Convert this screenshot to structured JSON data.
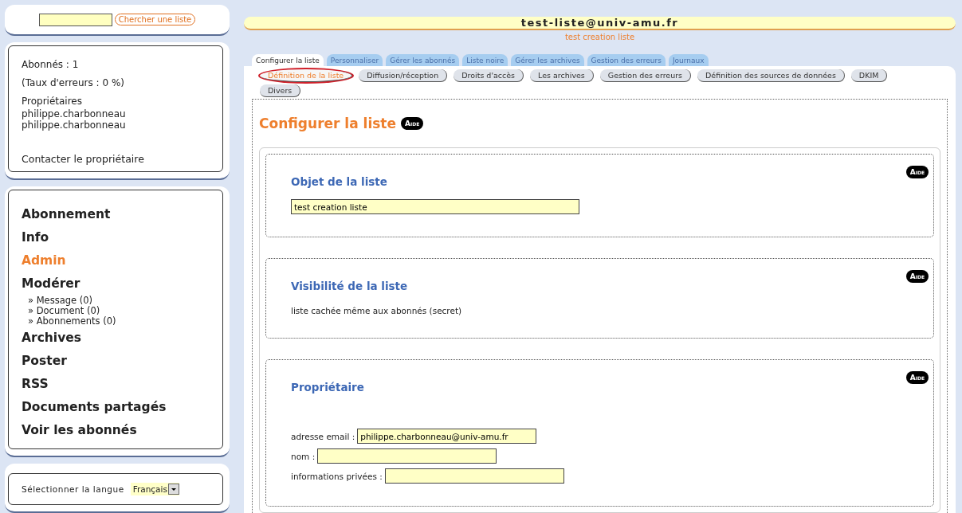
{
  "search": {
    "button": "Chercher une liste"
  },
  "list_info": {
    "subscribers": "Abonnés : 1",
    "error_rate": "(Taux d'erreurs : 0 %)",
    "owners_title": "Propriétaires",
    "owners": [
      "philippe.charbonneau",
      "philippe.charbonneau"
    ],
    "contact": "Contacter le propriétaire"
  },
  "menu": [
    {
      "label": "Abonnement",
      "selected": false
    },
    {
      "label": "Info",
      "selected": false
    },
    {
      "label": "Admin",
      "selected": true
    },
    {
      "label": "Modérer",
      "selected": false,
      "children": [
        {
          "label": "» Message (0)"
        },
        {
          "label": "» Document (0)"
        },
        {
          "label": "» Abonnements (0)"
        }
      ]
    },
    {
      "label": "Archives",
      "selected": false
    },
    {
      "label": "Poster",
      "selected": false
    },
    {
      "label": "RSS",
      "selected": false
    },
    {
      "label": "Documents partagés",
      "selected": false
    },
    {
      "label": "Voir les abonnés",
      "selected": false
    }
  ],
  "language": {
    "label": "Sélectionner la langue",
    "value": "Français"
  },
  "header": {
    "title": "test-liste@univ-amu.fr",
    "subtitle": "test creation liste"
  },
  "tabs": [
    {
      "label": "Configurer la liste",
      "selected": true
    },
    {
      "label": "Personnaliser",
      "selected": false
    },
    {
      "label": "Gérer les abonnés",
      "selected": false
    },
    {
      "label": "Liste noire",
      "selected": false
    },
    {
      "label": "Gérer les archives",
      "selected": false
    },
    {
      "label": "Gestion des erreurs",
      "selected": false
    },
    {
      "label": "Journaux",
      "selected": false
    }
  ],
  "subtabs": [
    {
      "label": "Définition de la liste",
      "selected": true,
      "circled": true
    },
    {
      "label": "Diffusion/réception",
      "selected": false,
      "circled": false
    },
    {
      "label": "Droits d'accès",
      "selected": false,
      "circled": false
    },
    {
      "label": "Les archives",
      "selected": false,
      "circled": false
    },
    {
      "label": "Gestion des erreurs",
      "selected": false,
      "circled": false
    },
    {
      "label": "Définition des sources de données",
      "selected": false,
      "circled": false
    },
    {
      "label": "DKIM",
      "selected": false,
      "circled": false
    },
    {
      "label": "Divers",
      "selected": false,
      "circled": false
    }
  ],
  "page_title": "Configurer la liste",
  "help": "Aide",
  "sections": [
    {
      "title": "Objet de la liste",
      "help": "Aide",
      "kind": "input",
      "value": "test creation liste"
    },
    {
      "title": "Visibilité de la liste",
      "help": "Aide",
      "kind": "text",
      "text": "liste cachée même aux abonnés (secret)"
    },
    {
      "title": "Propriétaire",
      "help": "Aide",
      "kind": "fields",
      "fields": [
        {
          "label": "adresse email :",
          "value": "philippe.charbonneau@univ-amu.fr"
        },
        {
          "label": "nom :"
        },
        {
          "label": "informations privées :"
        }
      ]
    }
  ]
}
